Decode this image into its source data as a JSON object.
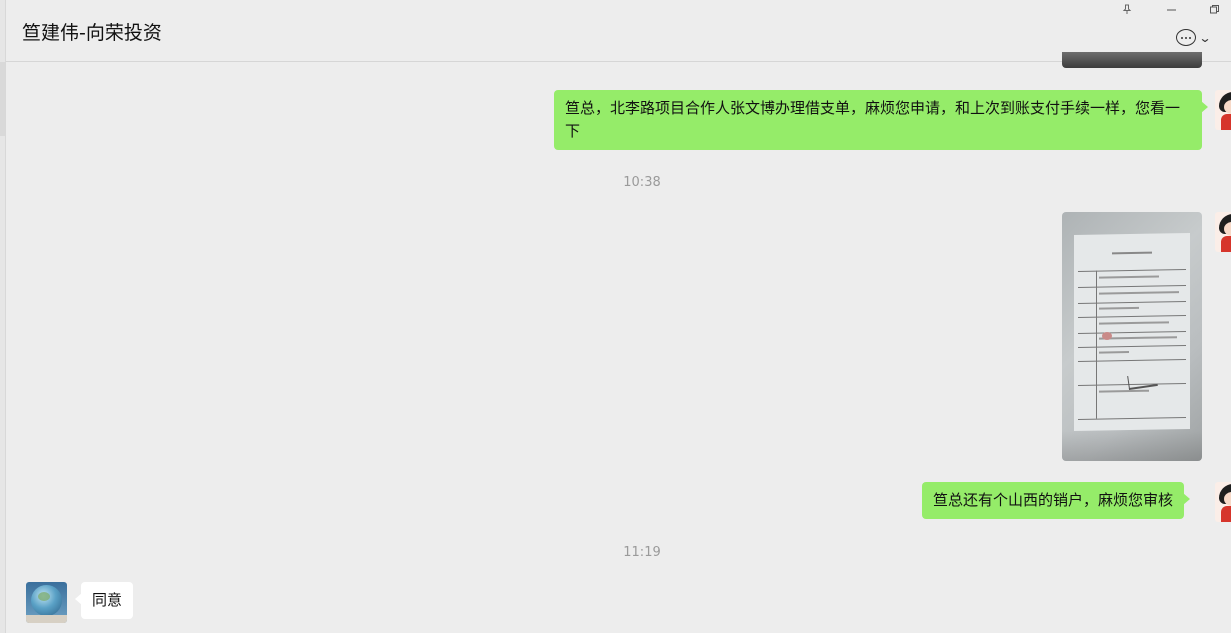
{
  "header": {
    "title": "笪建伟-向荣投资"
  },
  "window_controls": {
    "pin_icon": "pin-icon",
    "minimize_icon": "minimize-icon",
    "maximize_icon": "maximize-icon"
  },
  "messages": [
    {
      "sender": "me",
      "type": "text",
      "text": "笪总，北李路项目合作人张文博办理借支单，麻烦您申请，和上次到账支付手续一样，您看一下"
    },
    {
      "type": "timestamp",
      "text": "10:38"
    },
    {
      "sender": "me",
      "type": "image"
    },
    {
      "sender": "me",
      "type": "text",
      "text": "笪总还有个山西的销户，麻烦您审核"
    },
    {
      "type": "timestamp",
      "text": "11:19"
    },
    {
      "sender": "them",
      "type": "text",
      "text": "同意"
    }
  ],
  "colors": {
    "background": "#ededed",
    "my_bubble": "#95ec69",
    "their_bubble": "#ffffff",
    "timestamp": "#9a9a9a"
  }
}
